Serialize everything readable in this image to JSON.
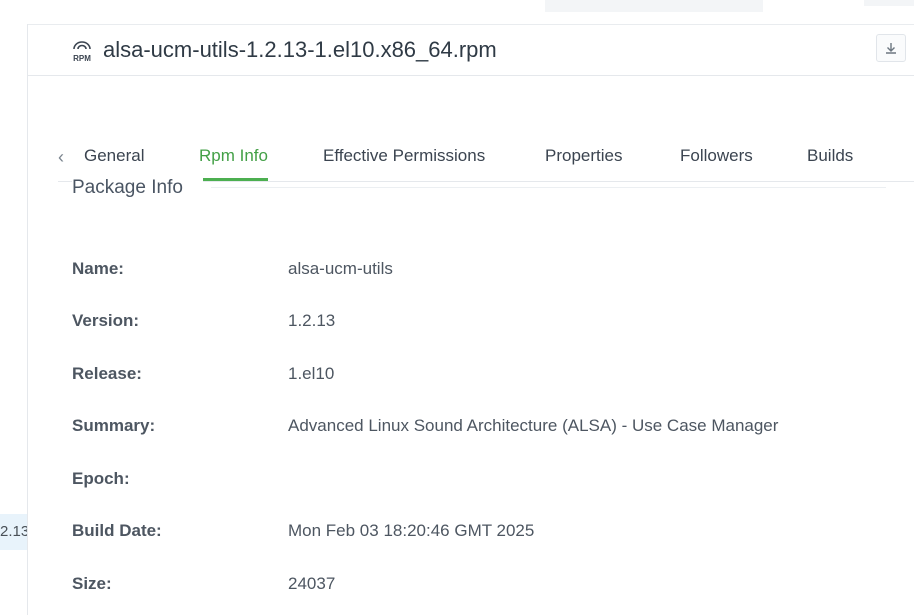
{
  "background": {
    "row_text": "2.13"
  },
  "header": {
    "icon": "rpm-file-icon",
    "title": "alsa-ucm-utils-1.2.13-1.el10.x86_64.rpm",
    "download_icon": "download-icon"
  },
  "tabs": [
    {
      "label": "General",
      "active": false
    },
    {
      "label": "Rpm Info",
      "active": true
    },
    {
      "label": "Effective Permissions",
      "active": false
    },
    {
      "label": "Properties",
      "active": false
    },
    {
      "label": "Followers",
      "active": false
    },
    {
      "label": "Builds",
      "active": false
    }
  ],
  "section": {
    "title": "Package Info"
  },
  "package_info": [
    {
      "label": "Name:",
      "value": "alsa-ucm-utils"
    },
    {
      "label": "Version:",
      "value": "1.2.13"
    },
    {
      "label": "Release:",
      "value": "1.el10"
    },
    {
      "label": "Summary:",
      "value": "Advanced Linux Sound Architecture (ALSA) - Use Case Manager"
    },
    {
      "label": "Epoch:",
      "value": ""
    },
    {
      "label": "Build Date:",
      "value": "Mon Feb 03 18:20:46 GMT 2025"
    },
    {
      "label": "Size:",
      "value": "24037"
    }
  ],
  "colors": {
    "accent": "#4caf50",
    "text": "#4d5661"
  }
}
